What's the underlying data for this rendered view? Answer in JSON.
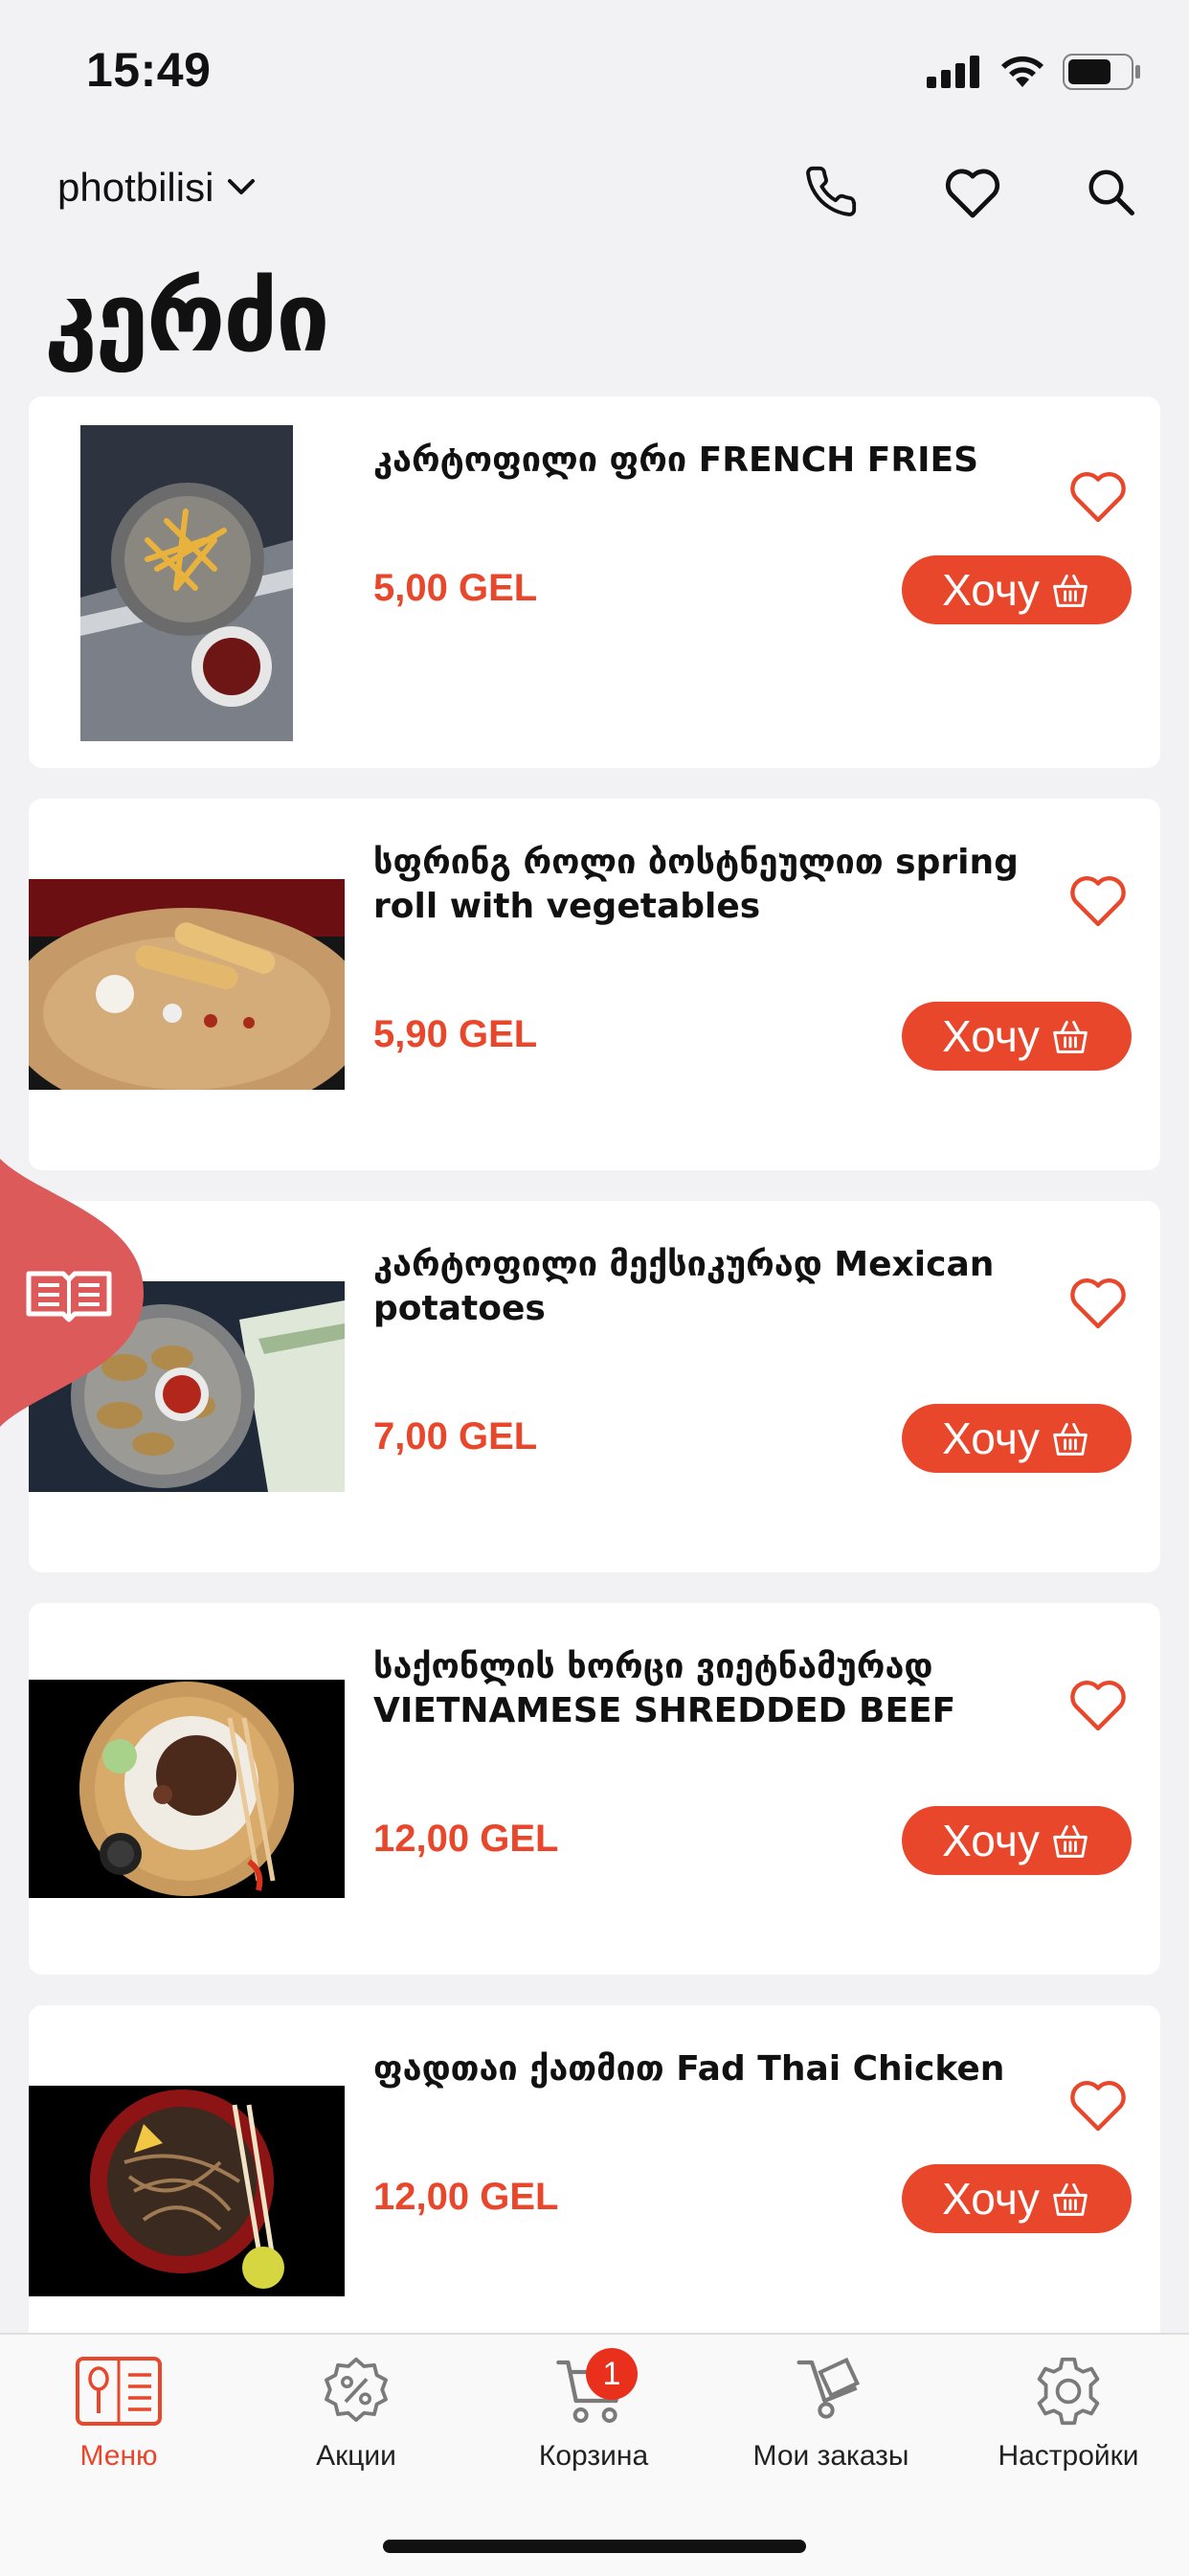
{
  "status": {
    "time": "15:49"
  },
  "header": {
    "brand": "photbilisi"
  },
  "page": {
    "title": "კერძი"
  },
  "products": [
    {
      "name": "კარტოფილი ფრი FRENCH FRIES",
      "price": "5,00 GEL",
      "button": "Хочу"
    },
    {
      "name": "სფრინგ როლი ბოსტნეულით spring roll with vegetables",
      "price": "5,90 GEL",
      "button": "Хочу"
    },
    {
      "name": "კარტოფილი მექსიკურად Mexican potatoes",
      "price": "7,00 GEL",
      "button": "Хочу"
    },
    {
      "name": "საქონლის ხორცი ვიეტნამურად VIETNAMESE SHREDDED BEEF",
      "price": "12,00 GEL",
      "button": "Хочу"
    },
    {
      "name": "ფადთაი ქათმით Fad Thai Chicken",
      "price": "12,00 GEL",
      "button": "Хочу"
    }
  ],
  "tabs": [
    {
      "label": "Меню",
      "icon": "menu-book-icon",
      "active": true
    },
    {
      "label": "Акции",
      "icon": "discount-icon"
    },
    {
      "label": "Корзина",
      "icon": "cart-icon",
      "badge": "1"
    },
    {
      "label": "Мои заказы",
      "icon": "orders-icon"
    },
    {
      "label": "Настройки",
      "icon": "settings-icon"
    }
  ],
  "colors": {
    "accent": "#e8472b",
    "side_tab": "#dd5a5a",
    "background": "#f2f2f4"
  }
}
